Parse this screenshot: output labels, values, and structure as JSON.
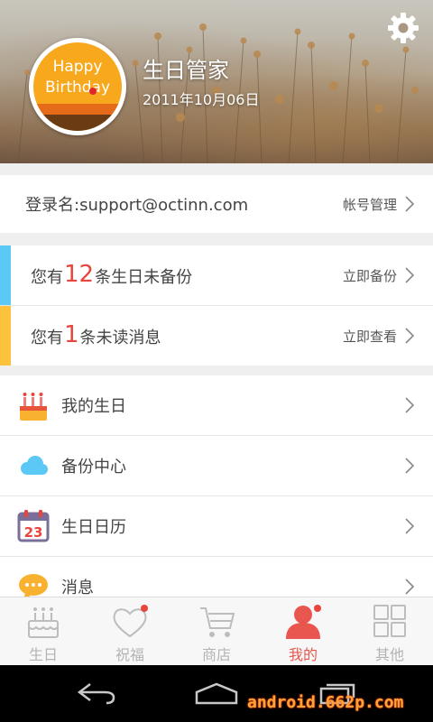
{
  "header": {
    "app_title": "生日管家",
    "date": "2011年10月06日",
    "avatar_text_line1": "Happy",
    "avatar_text_line2": "Birthday"
  },
  "account": {
    "login_label": "登录名:support@octinn.com",
    "action": "帐号管理"
  },
  "alerts": [
    {
      "prefix": "您有",
      "count": "12",
      "suffix": "条生日未备份",
      "action": "立即备份",
      "stripe_color": "#5bc8f5"
    },
    {
      "prefix": "您有",
      "count": "1",
      "suffix": "条未读消息",
      "action": "立即查看",
      "stripe_color": "#fcc23b"
    }
  ],
  "menu": [
    {
      "label": "我的生日",
      "icon": "cake-icon"
    },
    {
      "label": "备份中心",
      "icon": "cloud-icon"
    },
    {
      "label": "生日日历",
      "icon": "calendar-icon",
      "icon_text": "23"
    },
    {
      "label": "消息",
      "icon": "message-icon"
    }
  ],
  "tabs": [
    {
      "label": "生日",
      "icon": "cake-outline-icon",
      "active": false,
      "dot": false
    },
    {
      "label": "祝福",
      "icon": "heart-outline-icon",
      "active": false,
      "dot": true
    },
    {
      "label": "商店",
      "icon": "cart-outline-icon",
      "active": false,
      "dot": false
    },
    {
      "label": "我的",
      "icon": "person-icon",
      "active": true,
      "dot": true
    },
    {
      "label": "其他",
      "icon": "grid-icon",
      "active": false,
      "dot": false
    }
  ],
  "watermark": "android.662p.com",
  "colors": {
    "accent": "#e8463d",
    "tab_active": "#e8564f",
    "tab_inactive": "#b3b3b3"
  }
}
